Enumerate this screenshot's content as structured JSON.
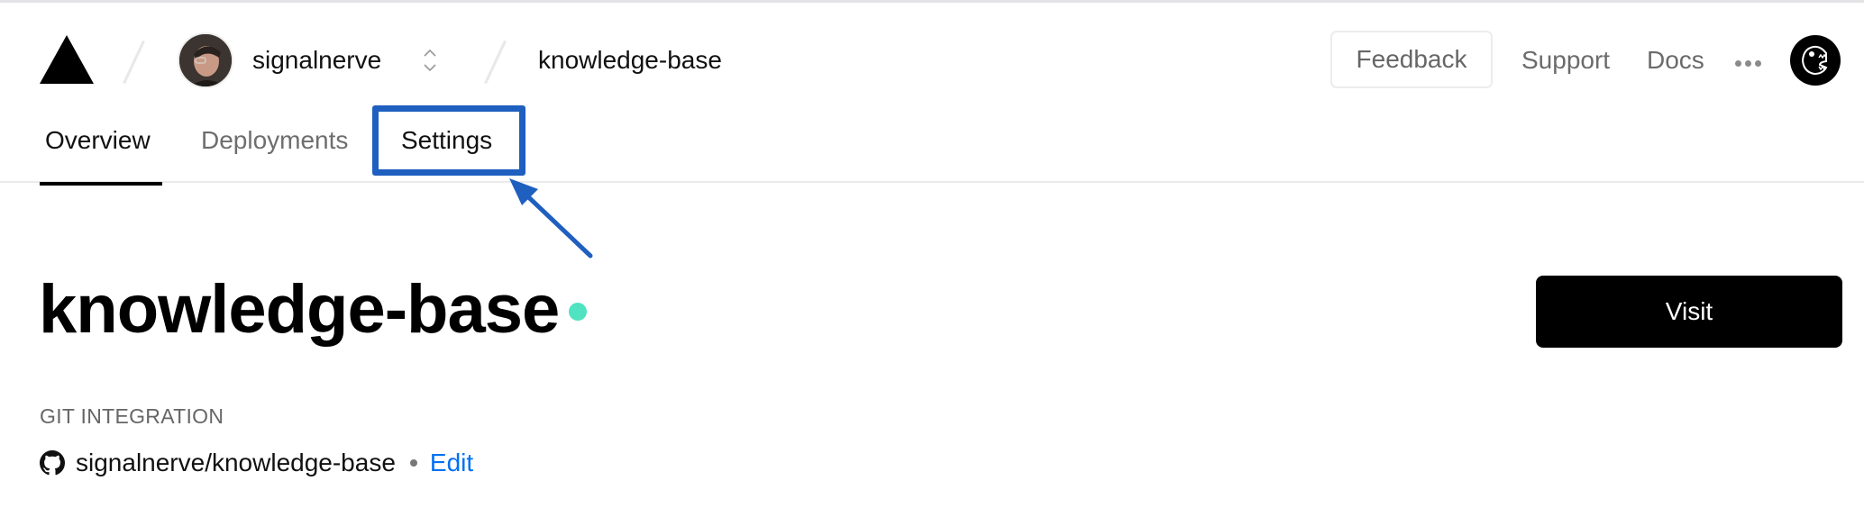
{
  "header": {
    "team": {
      "name": "signalnerve"
    },
    "project": {
      "name": "knowledge-base"
    },
    "actions": {
      "feedback_label": "Feedback",
      "support_label": "Support",
      "docs_label": "Docs"
    }
  },
  "tabs": [
    {
      "label": "Overview",
      "active": true
    },
    {
      "label": "Deployments",
      "active": false
    },
    {
      "label": "Settings",
      "active": false,
      "highlighted": true
    }
  ],
  "main": {
    "title": "knowledge-base",
    "status_color": "#50e3c2",
    "visit_label": "Visit",
    "git": {
      "section_label": "GIT INTEGRATION",
      "repo": "signalnerve/knowledge-base",
      "edit_label": "Edit"
    }
  },
  "colors": {
    "accent_link": "#0070f3",
    "annotation": "#1f5fbf",
    "primary_button": "#000000"
  }
}
